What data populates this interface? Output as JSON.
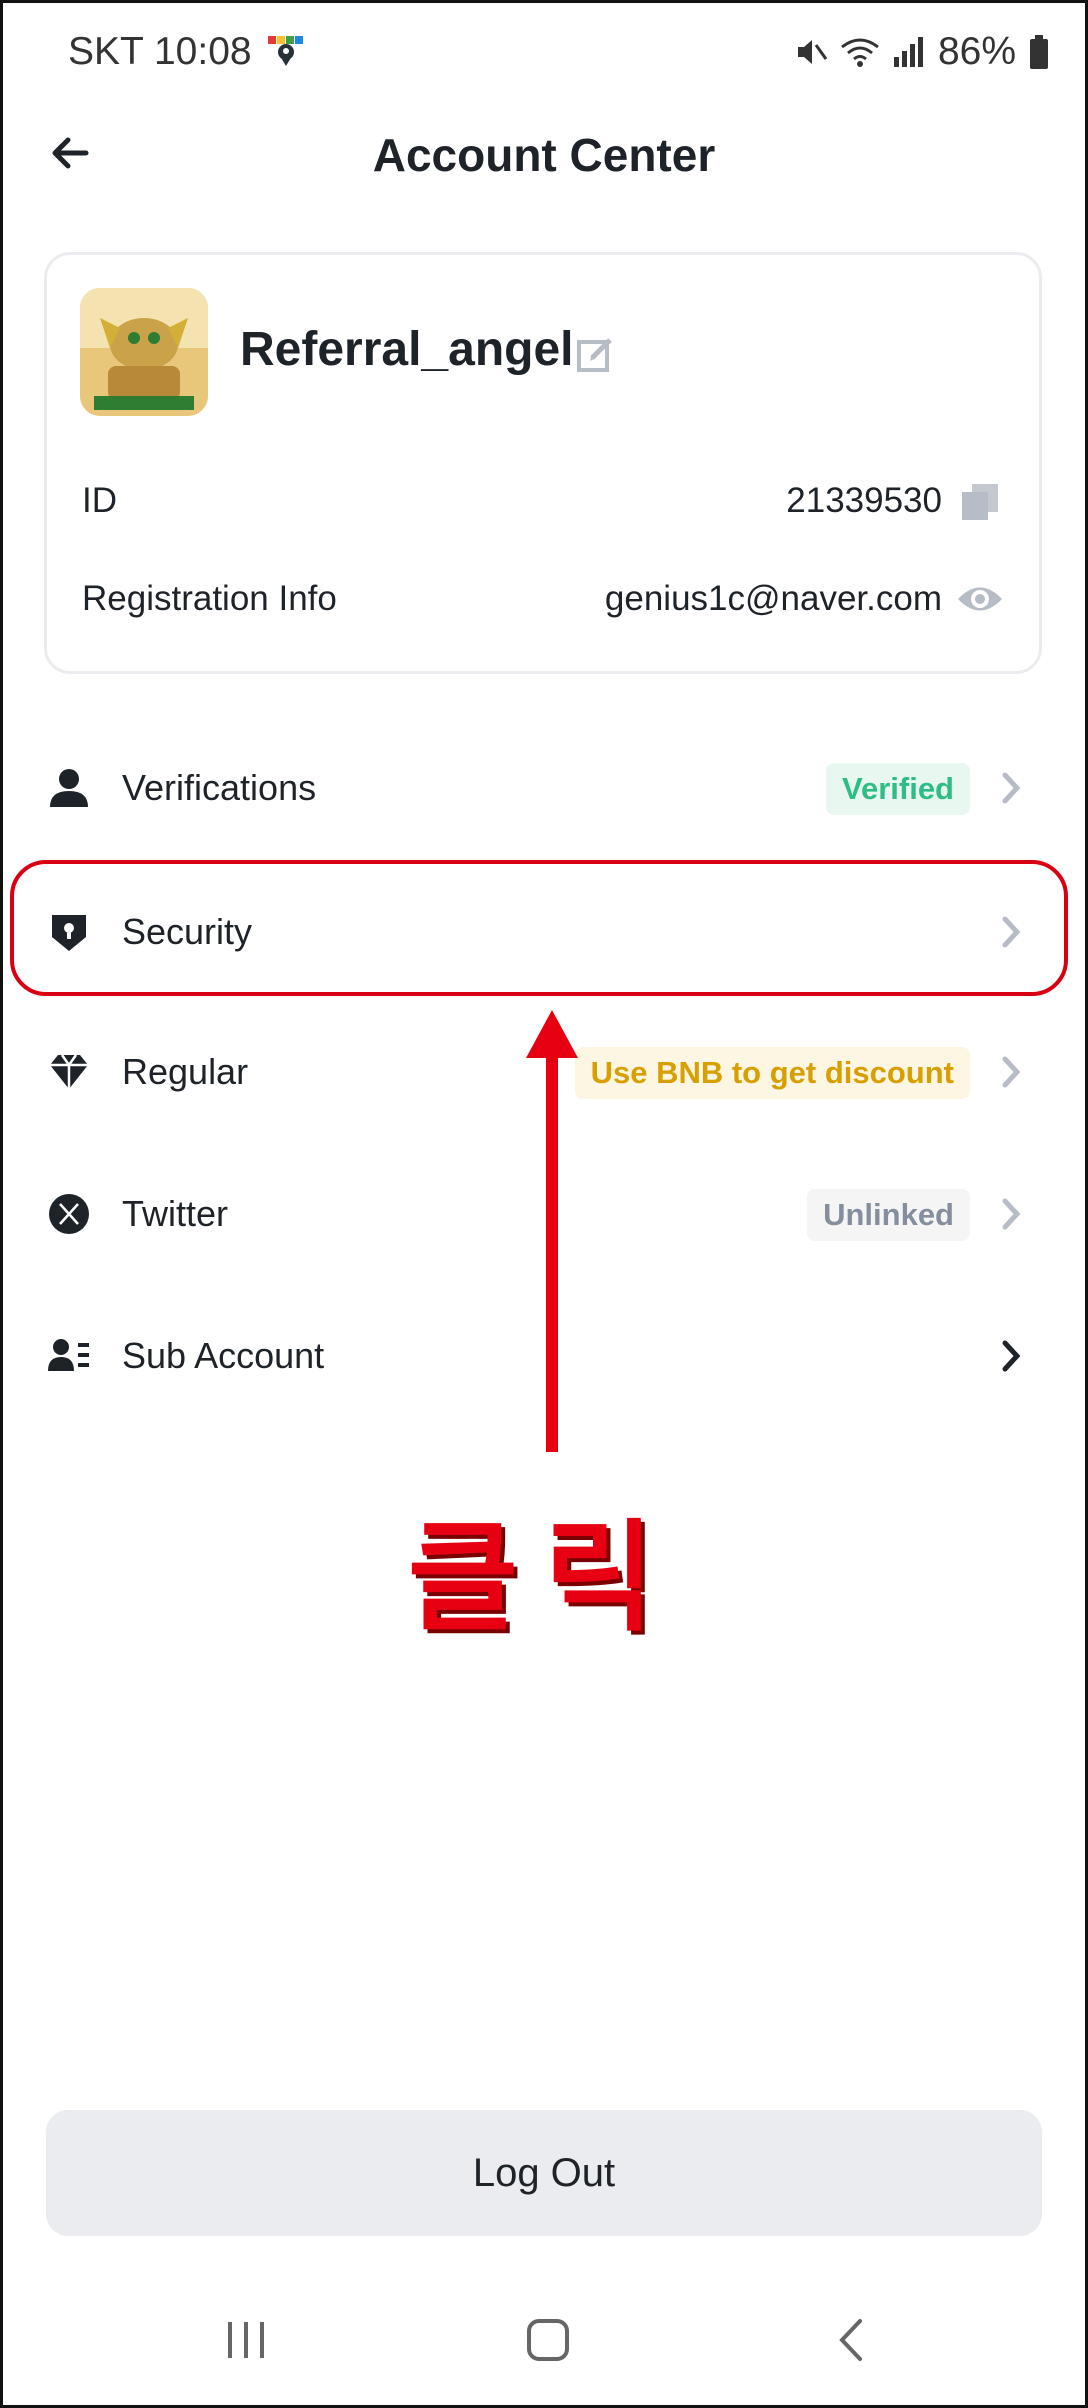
{
  "status_bar": {
    "carrier_time": "SKT 10:08",
    "battery": "86%"
  },
  "header": {
    "title": "Account Center"
  },
  "profile": {
    "username": "Referral_angel",
    "id_label": "ID",
    "id_value": "21339530",
    "registration_label": "Registration Info",
    "registration_value": "genius1c@naver.com"
  },
  "menu": [
    {
      "label": "Verifications",
      "badge": "Verified",
      "badge_color": "#2ebd85",
      "badge_bg": "#e8f8f1",
      "icon": "person-icon"
    },
    {
      "label": "Security",
      "badge": "",
      "icon": "shield-icon"
    },
    {
      "label": "Regular",
      "badge": "Use BNB to get discount",
      "badge_color": "#d89f00",
      "badge_bg": "#fdf6e2",
      "icon": "diamond-icon"
    },
    {
      "label": "Twitter",
      "badge": "Unlinked",
      "badge_color": "#848e9c",
      "badge_bg": "#f5f5f5",
      "icon": "x-logo-icon"
    },
    {
      "label": "Sub Account",
      "badge": "",
      "icon": "sub-account-icon"
    }
  ],
  "annotation": {
    "text": "클릭",
    "color": "#e60012"
  },
  "logout_label": "Log Out"
}
